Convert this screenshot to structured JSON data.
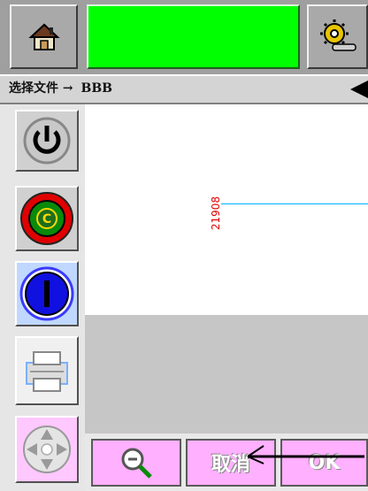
{
  "path_bar": {
    "label": "选择文件",
    "arrow": "→",
    "file_name": "BBB"
  },
  "canvas": {
    "counter_value": "21908"
  },
  "toolbar": {
    "home_icon": "home-icon",
    "settings_icon": "gear-wrench-icon"
  },
  "sidebar": {
    "items": [
      {
        "icon": "power-icon"
      },
      {
        "icon": "jet-status-icon"
      },
      {
        "icon": "print-start-icon"
      },
      {
        "icon": "printer-icon"
      },
      {
        "icon": "direction-pad-icon"
      }
    ]
  },
  "bottom_bar": {
    "cancel_label": "取消",
    "ok_label": "OK",
    "zoom_icon": "zoom-icon"
  },
  "colors": {
    "title_green": "#00ff00",
    "button_pink": "#ffb0ff",
    "counter_red": "#e00000",
    "line_cyan": "#00b0ff"
  }
}
